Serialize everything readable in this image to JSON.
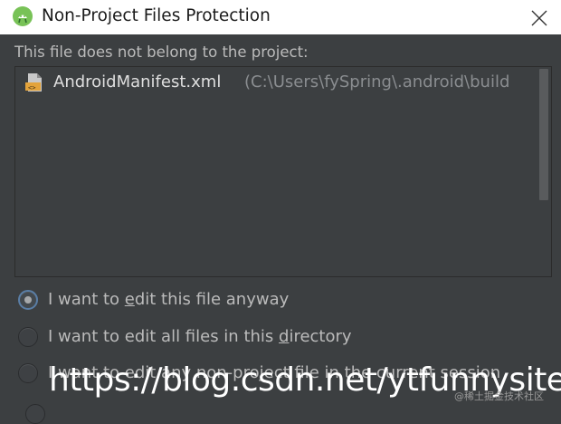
{
  "window": {
    "title": "Non-Project Files Protection",
    "app_icon": "android-studio-icon",
    "close_icon": "close-icon"
  },
  "description": "This file does not belong to the project:",
  "files": [
    {
      "icon": "xml-file-icon",
      "name": "AndroidManifest.xml",
      "path": "(C:\\Users\\fySpring\\.android\\build"
    }
  ],
  "options": [
    {
      "before": "I want to ",
      "mnemonic": "e",
      "after": "dit this file anyway",
      "checked": true
    },
    {
      "before": "I want to edit all files in this ",
      "mnemonic": "d",
      "after": "irectory",
      "checked": false
    },
    {
      "before": "",
      "mnemonic": "",
      "after": "I want to edit any non-project file in the current session",
      "checked": false
    }
  ],
  "watermark": {
    "main": "https://blog.csdn.net/ytfunnysite",
    "small": "@稀土掘金技术社区"
  },
  "colors": {
    "background": "#3c3f41",
    "titlebar": "#ffffff",
    "text": "#bbbbbb",
    "path_text": "#8a8d90",
    "radio_selected_border": "#5a7ea6"
  }
}
